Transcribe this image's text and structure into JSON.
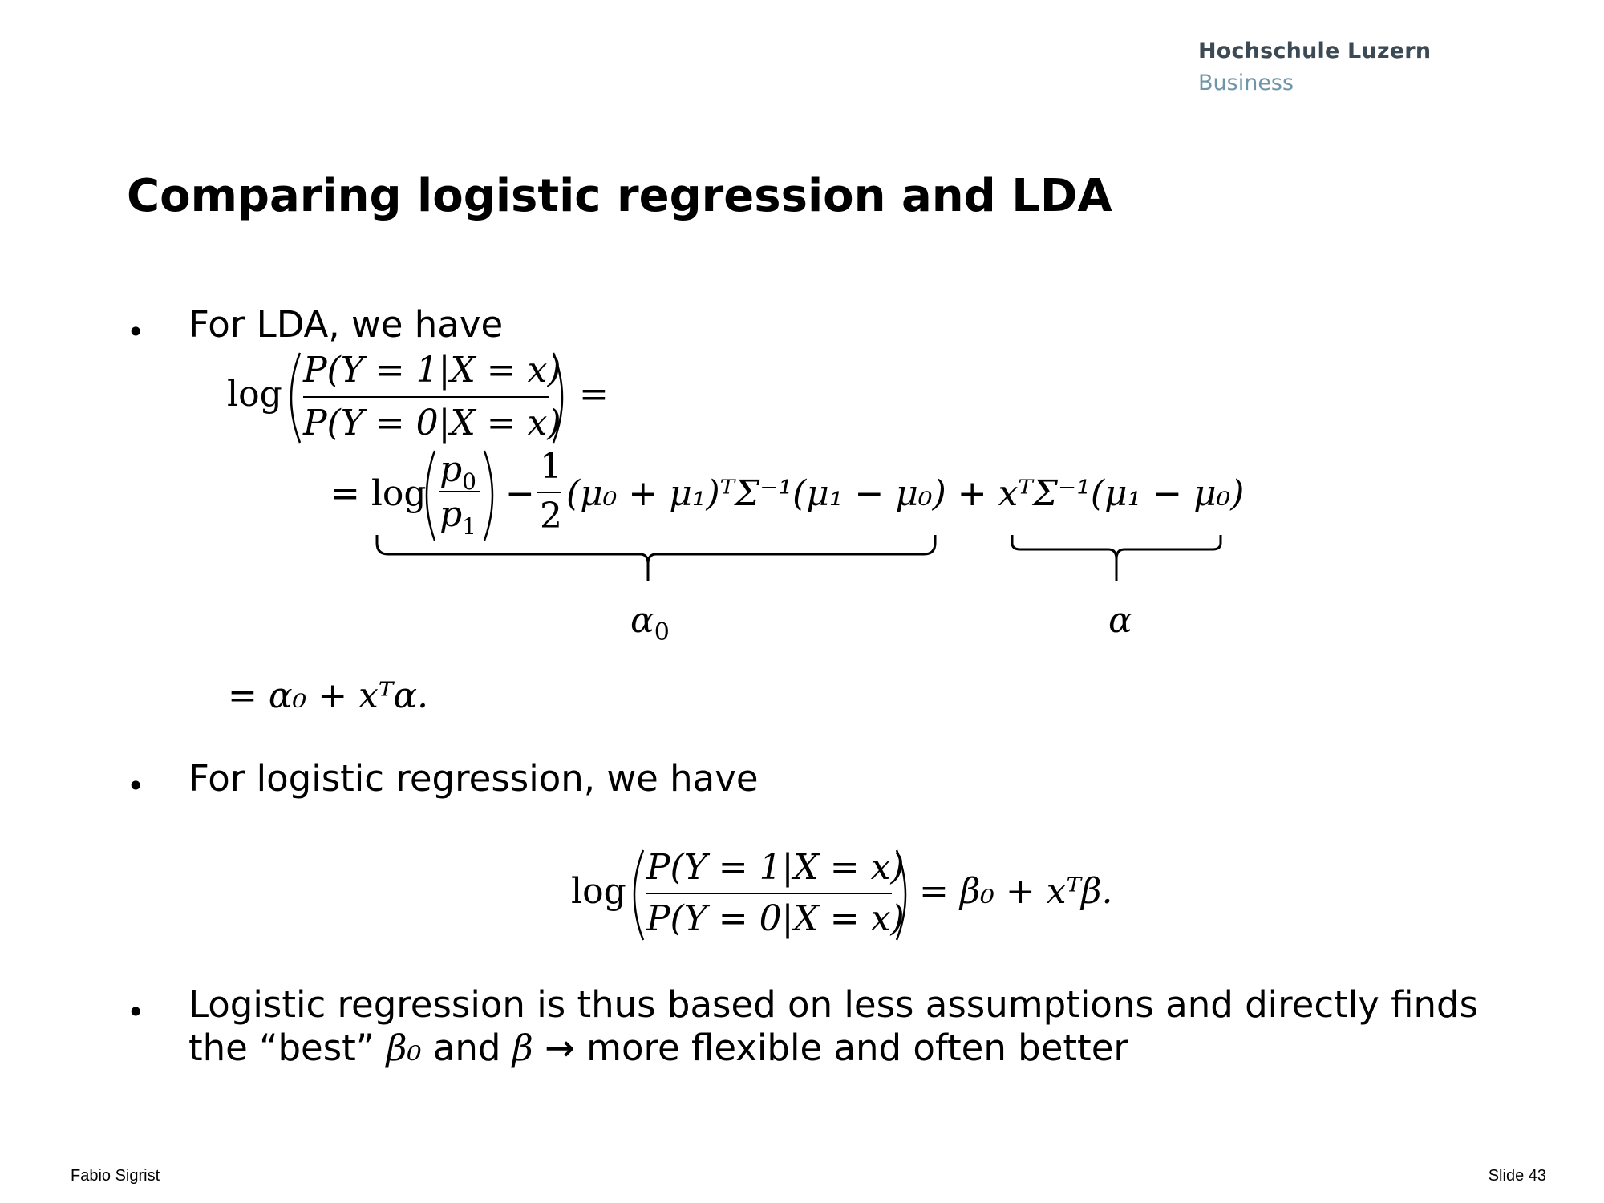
{
  "header": {
    "logo_line1": "Hochschule Luzern",
    "logo_line2": "Business"
  },
  "slide": {
    "title": "Comparing logistic regression and LDA",
    "bullet_char": "•",
    "bullets": [
      {
        "text": "For LDA, we have"
      },
      {
        "text": "For logistic regression, we have"
      },
      {
        "line1": "Logistic regression is thus based on less assumptions and directly finds",
        "line2_prefix": "the “best”",
        "line2_mid": "and",
        "line2_arrow": "→",
        "line2_suffix": "more flexible and often better"
      }
    ],
    "formulas": {
      "log": "log",
      "lda_num": "P(Y = 1|X = x)",
      "lda_den": "P(Y = 0|X = x)",
      "equals": "=",
      "eq_line2_prefix": "= log",
      "p0": "p",
      "p0_sub": "0",
      "p1": "p",
      "p1_sub": "1",
      "minus": "−",
      "half_num": "1",
      "half_den": "2",
      "rest": "(μ₀ + μ₁)ᵀΣ⁻¹(μ₁ − μ₀) + xᵀΣ⁻¹(μ₁ − μ₀)",
      "alpha0": "α",
      "alpha0_sub": "0",
      "alpha": "α",
      "final": "= α₀ + xᵀα.",
      "lr_num": "P(Y = 1|X = x)",
      "lr_den": "P(Y = 0|X = x)",
      "lr_rhs": "= β₀ + xᵀβ.",
      "beta0": "β₀",
      "beta": "β"
    }
  },
  "footer": {
    "author": "Fabio Sigrist",
    "slide_number": "Slide 43"
  }
}
